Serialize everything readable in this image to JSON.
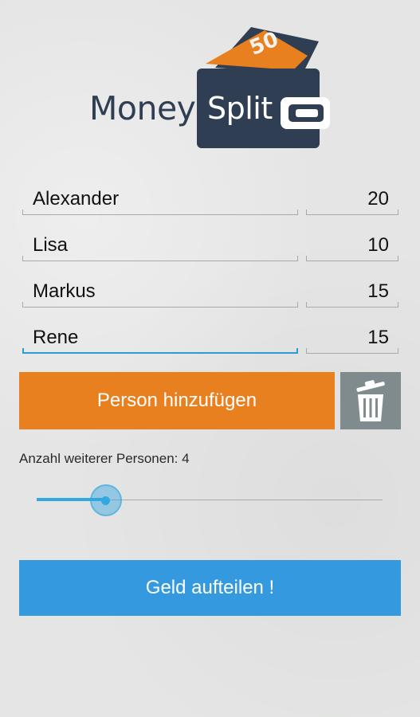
{
  "app": {
    "logo_word_1": "Money",
    "logo_word_2": "Split",
    "logo_banknote_value": "50"
  },
  "persons": [
    {
      "name": "Alexander",
      "amount": "20"
    },
    {
      "name": "Lisa",
      "amount": "10"
    },
    {
      "name": "Markus",
      "amount": "15"
    },
    {
      "name": "Rene",
      "amount": "15",
      "focused": true
    }
  ],
  "actions": {
    "add_person_label": "Person hinzufügen",
    "delete_icon": "trash-icon",
    "split_label": "Geld aufteilen !"
  },
  "additional_persons": {
    "label": "Anzahl weiterer Personen: 4",
    "value": 4,
    "slider_fraction": 0.2
  },
  "colors": {
    "background": "#e4e5e4",
    "brand_dark": "#2f3e52",
    "brand_orange": "#e9801f",
    "accent_blue": "#3599df",
    "trash_gray": "#7f8b8d"
  }
}
